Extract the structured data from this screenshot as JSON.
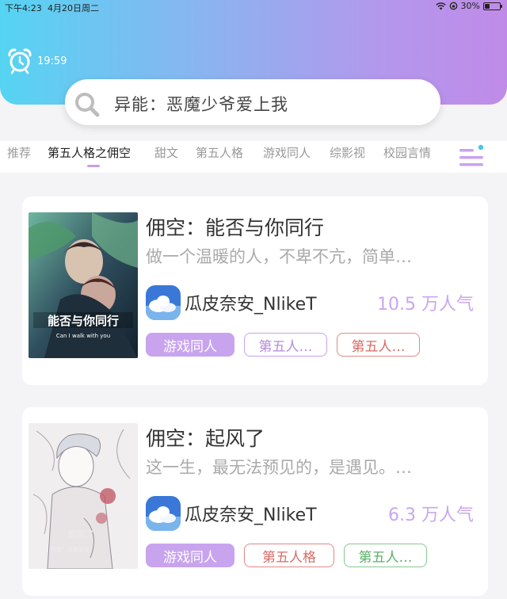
{
  "status_bar": {
    "time": "下午4:23",
    "date": "4月20日周二",
    "battery": "30%"
  },
  "clock": {
    "time": "19:59",
    "icon": "alarm-clock-icon"
  },
  "search": {
    "text": "异能：恶魔少爷爱上我",
    "icon": "search-icon"
  },
  "tabs": [
    {
      "label": "推荐",
      "active": false
    },
    {
      "label": "第五人格之佣空",
      "active": true
    },
    {
      "label": "甜文",
      "active": false
    },
    {
      "label": "第五人格",
      "active": false
    },
    {
      "label": "游戏同人",
      "active": false
    },
    {
      "label": "综影视",
      "active": false
    },
    {
      "label": "校园言情",
      "active": false
    }
  ],
  "books": [
    {
      "title": "佣空：能否与你同行",
      "description": "做一个温暖的人，不卑不亢，简单…",
      "author": "瓜皮奈安_NlikeT",
      "popularity": "10.5 万人气",
      "tags": [
        "游戏同人",
        "第五人…",
        "第五人…"
      ]
    },
    {
      "title": "佣空：起风了",
      "description": "这一生，最无法预见的，是遇见。…",
      "author": "瓜皮奈安_NlikeT",
      "popularity": "6.3 万人气",
      "tags": [
        "游戏同人",
        "第五人格",
        "第五人…"
      ]
    }
  ],
  "colors": {
    "header_gradient_start": "#55d4f2",
    "header_gradient_end": "#c08be8",
    "accent_purple": "#c8a3ee",
    "tag_red": "#d86c66",
    "tag_green": "#5ab06a"
  }
}
